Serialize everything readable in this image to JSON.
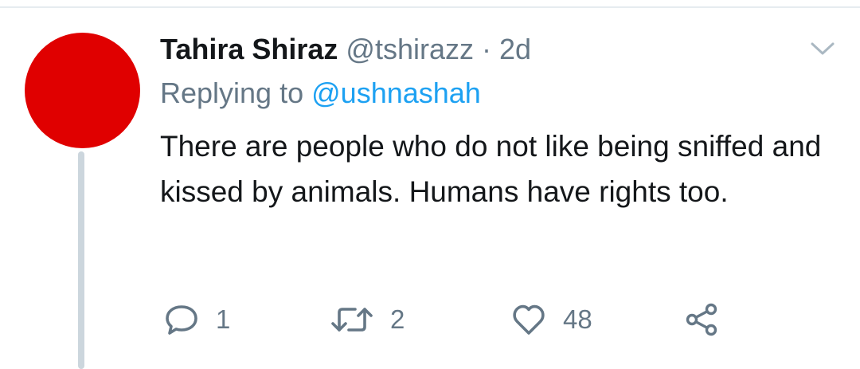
{
  "colors": {
    "avatar": "#e00000",
    "name": "#14171a",
    "secondary": "#657786",
    "link": "#1da1f2",
    "thread_line": "#ccd6dd",
    "divider": "#e6ecf0"
  },
  "tweet": {
    "display_name": "Tahira Shiraz",
    "handle": "@tshirazz",
    "separator": "·",
    "time": "2d",
    "replying_prefix": "Replying to",
    "replying_to": "@ushnashah",
    "text": "There are people who do not like being sniffed and kissed by animals. Humans have rights too."
  },
  "actions": {
    "reply": {
      "icon": "reply-icon",
      "count": "1"
    },
    "retweet": {
      "icon": "retweet-icon",
      "count": "2"
    },
    "like": {
      "icon": "heart-icon",
      "count": "48"
    },
    "share": {
      "icon": "share-icon"
    }
  },
  "menu": {
    "icon": "chevron-down-icon"
  }
}
